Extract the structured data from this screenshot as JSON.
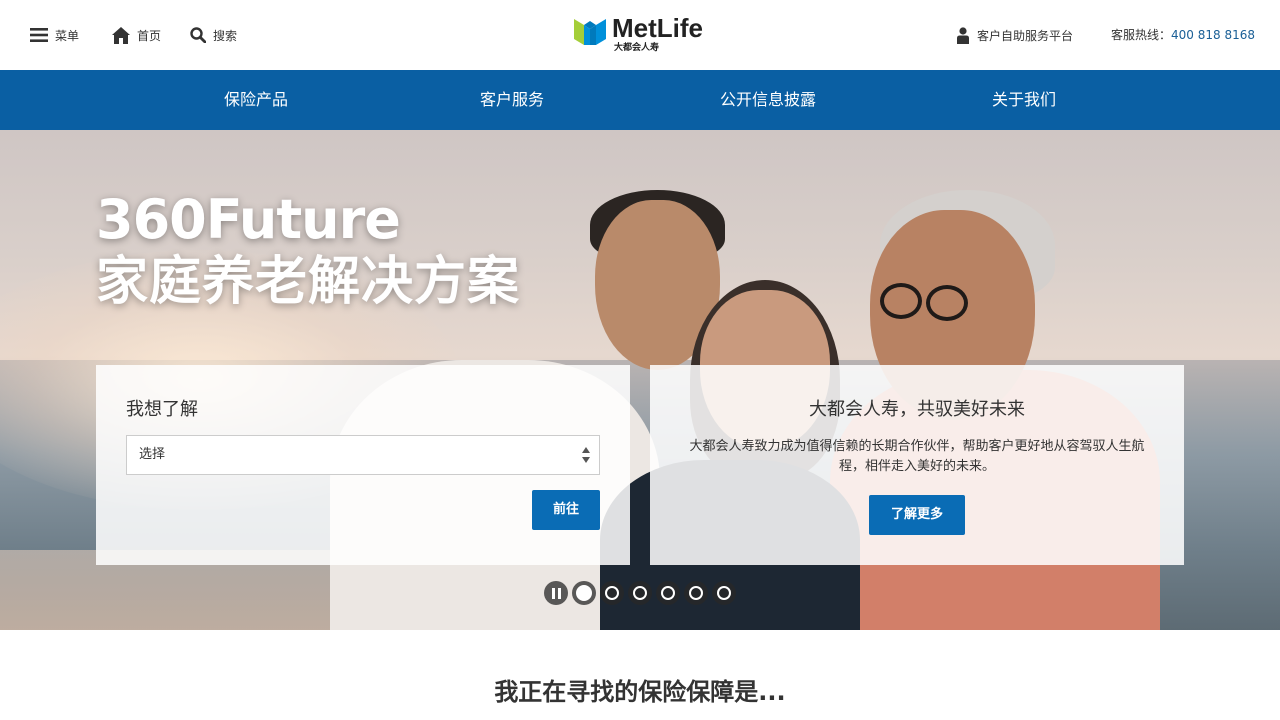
{
  "topbar": {
    "menu_label": "菜单",
    "home_label": "首页",
    "search_label": "搜索",
    "logo_name": "MetLife",
    "logo_sub": "大都会人寿",
    "platform_label": "客户自助服务平台",
    "hotline_label": "客服热线：",
    "hotline_number": "400 818 8168"
  },
  "nav": {
    "items": [
      {
        "label": "保险产品"
      },
      {
        "label": "客户服务"
      },
      {
        "label": "公开信息披露"
      },
      {
        "label": "关于我们"
      }
    ]
  },
  "hero": {
    "title_line1": "360Future",
    "title_line2": "家庭养老解决方案",
    "left_panel": {
      "title": "我想了解",
      "select_value": "选择",
      "go_button": "前往"
    },
    "right_panel": {
      "title": "大都会人寿，共驭美好未来",
      "description": "大都会人寿致力成为值得信赖的长期合作伙伴，帮助客户更好地从容驾驭人生航程，相伴走入美好的未来。",
      "more_button": "了解更多"
    },
    "carousel": {
      "slide_count": 6,
      "active_index": 0
    }
  },
  "section": {
    "title": "我正在寻找的保险保障是..."
  },
  "colors": {
    "brand_blue": "#0a5fa3",
    "button_blue": "#0a6cb5",
    "logo_green": "#a4ce39",
    "logo_blue": "#0090da",
    "logo_teal": "#007abc"
  }
}
